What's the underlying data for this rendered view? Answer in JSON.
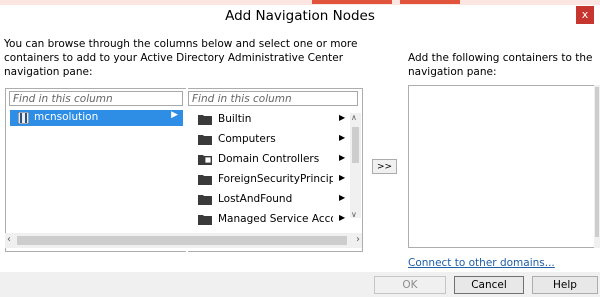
{
  "window": {
    "title": "Add Navigation Nodes",
    "close_glyph": "x"
  },
  "instructions": {
    "left": "You can browse through the columns below and select one or more containers to add to your Active Directory Administrative Center navigation pane:",
    "right": "Add the following containers to the navigation pane:"
  },
  "column1": {
    "filter_placeholder": "Find in this column",
    "items": [
      {
        "label": "mcnsolution",
        "icon": "domain-server-icon",
        "selected": true
      }
    ]
  },
  "column2": {
    "filter_placeholder": "Find in this column",
    "items": [
      {
        "label": "Builtin",
        "icon": "folder-icon"
      },
      {
        "label": "Computers",
        "icon": "folder-icon"
      },
      {
        "label": "Domain Controllers",
        "icon": "ou-icon"
      },
      {
        "label": "ForeignSecurityPrincipa",
        "icon": "folder-icon"
      },
      {
        "label": "LostAndFound",
        "icon": "folder-icon"
      },
      {
        "label": "Managed Service Accou",
        "icon": "folder-icon"
      }
    ]
  },
  "add_button": {
    "label": ">>"
  },
  "connect_link": "Connect to other domains...",
  "buttons": {
    "ok": "OK",
    "cancel": "Cancel",
    "help": "Help"
  },
  "colors": {
    "selection": "#2e8ee5",
    "close": "#c7352f",
    "link": "#1f5ea8"
  }
}
